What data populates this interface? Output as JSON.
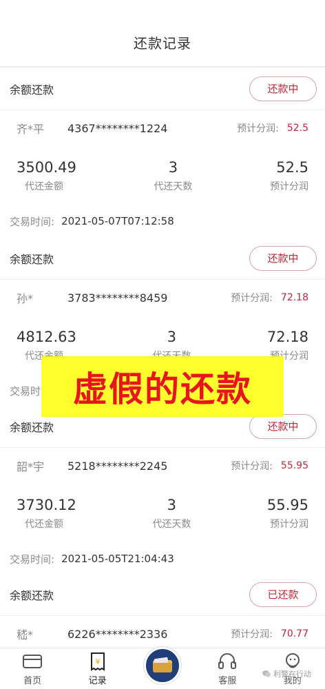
{
  "header": {
    "title": "还款记录"
  },
  "records": [
    {
      "type": "余额还款",
      "status": "还款中",
      "name": "齐*平",
      "card_no": "4367********1224",
      "est_label": "预计分润:",
      "est_value": "52.5",
      "amount": "3500.49",
      "amount_label": "代还金额",
      "days": "3",
      "days_label": "代还天数",
      "profit": "52.5",
      "profit_label": "预计分润",
      "time_label": "交易时间:",
      "time_value": "2021-05-07T07:12:58"
    },
    {
      "type": "余额还款",
      "status": "还款中",
      "name": "孙*",
      "card_no": "3783********8459",
      "est_label": "预计分润:",
      "est_value": "72.18",
      "amount": "4812.63",
      "amount_label": "代还金额",
      "days": "3",
      "days_label": "代还天数",
      "profit": "72.18",
      "profit_label": "预计分润",
      "time_label": "交易时间:",
      "time_value": ""
    },
    {
      "type": "余额还款",
      "status": "还款中",
      "name": "韶*宇",
      "card_no": "5218********2245",
      "est_label": "预计分润:",
      "est_value": "55.95",
      "amount": "3730.12",
      "amount_label": "代还金额",
      "days": "3",
      "days_label": "代还天数",
      "profit": "55.95",
      "profit_label": "预计分润",
      "time_label": "交易时间:",
      "time_value": "2021-05-05T21:04:43"
    },
    {
      "type": "余额还款",
      "status": "已还款",
      "name": "嵇*",
      "card_no": "6226********2336",
      "est_label": "预计分润:",
      "est_value": "70.77"
    }
  ],
  "overlay": {
    "text": "虚假的还款"
  },
  "tabbar": {
    "home": "首页",
    "records": "记录",
    "service": "客服",
    "mine": "我的"
  },
  "watermark": {
    "text": "利警在行动"
  },
  "colors": {
    "accent": "#c2263a",
    "overlay_bg": "#ffff2e",
    "overlay_text": "#e8141e"
  }
}
